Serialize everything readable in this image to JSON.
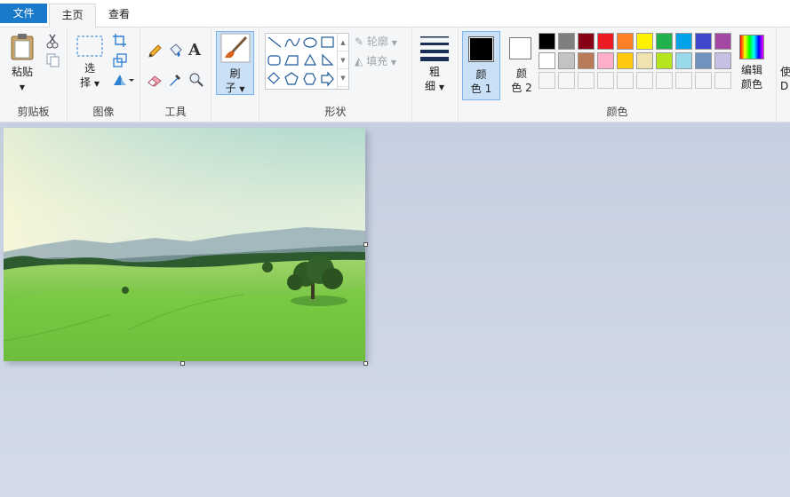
{
  "tabs": {
    "file": "文件",
    "home": "主页",
    "view": "查看"
  },
  "clipboard": {
    "paste": "粘贴",
    "label": "剪贴板"
  },
  "image": {
    "select_top": "选",
    "select_bottom": "择",
    "label": "图像"
  },
  "tools": {
    "label": "工具"
  },
  "brush": {
    "top": "刷",
    "bottom": "子"
  },
  "shapes": {
    "outline": "轮廓",
    "fill": "填充",
    "label": "形状"
  },
  "size": {
    "top": "粗",
    "bottom": "细"
  },
  "colors": {
    "color1_top": "颜",
    "color1_bottom": "色 1",
    "color2_top": "颜",
    "color2_bottom": "色 2",
    "edit_top": "编辑",
    "edit_bottom": "颜色",
    "label": "颜色",
    "color1_value": "#000000",
    "color2_value": "#ffffff",
    "row1": [
      "#000000",
      "#7f7f7f",
      "#880015",
      "#ed1c24",
      "#ff7f27",
      "#fff200",
      "#22b14c",
      "#00a2e8",
      "#3f48cc",
      "#a349a4"
    ],
    "row2": [
      "#ffffff",
      "#c3c3c3",
      "#b97a57",
      "#ffaec9",
      "#ffc90e",
      "#efe4b0",
      "#b5e61d",
      "#99d9ea",
      "#7092be",
      "#c8bfe7"
    ]
  },
  "cutoff": {
    "top": "使",
    "bottom": "D"
  },
  "accent": "#1979ca"
}
